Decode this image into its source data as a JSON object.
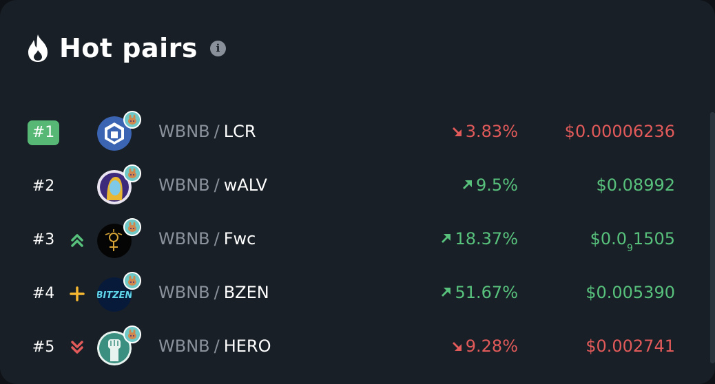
{
  "header": {
    "title": "Hot pairs",
    "info_glyph": "i"
  },
  "pairs": [
    {
      "rank": "#1",
      "base": "WBNB",
      "sep": "/",
      "quote": "LCR",
      "change": "3.83%",
      "direction": "down",
      "price": "$0.00006236",
      "trend": "none"
    },
    {
      "rank": "#2",
      "base": "WBNB",
      "sep": "/",
      "quote": "wALV",
      "change": "9.5%",
      "direction": "up",
      "price": "$0.08992",
      "trend": "none"
    },
    {
      "rank": "#3",
      "base": "WBNB",
      "sep": "/",
      "quote": "Fwc",
      "change": "18.37%",
      "direction": "up",
      "price_prefix": "$0.0",
      "price_sub": "9",
      "price_suffix": "1505",
      "trend": "rank-up"
    },
    {
      "rank": "#4",
      "base": "WBNB",
      "sep": "/",
      "quote": "BZEN",
      "change": "51.67%",
      "direction": "up",
      "price": "$0.005390",
      "trend": "new"
    },
    {
      "rank": "#5",
      "base": "WBNB",
      "sep": "/",
      "quote": "HERO",
      "change": "9.28%",
      "direction": "down",
      "price": "$0.002741",
      "trend": "rank-down"
    }
  ],
  "colors": {
    "up": "#58c27d",
    "down": "#e25a5a",
    "new": "#f5b731",
    "rank_badge": "#57b876"
  },
  "icons": {
    "header": "flame-icon",
    "info": "info-icon",
    "chain": "pancakeswap-icon",
    "logos": [
      "lcr-logo",
      "walv-logo",
      "fwc-logo",
      "bzen-logo",
      "hero-logo"
    ]
  }
}
